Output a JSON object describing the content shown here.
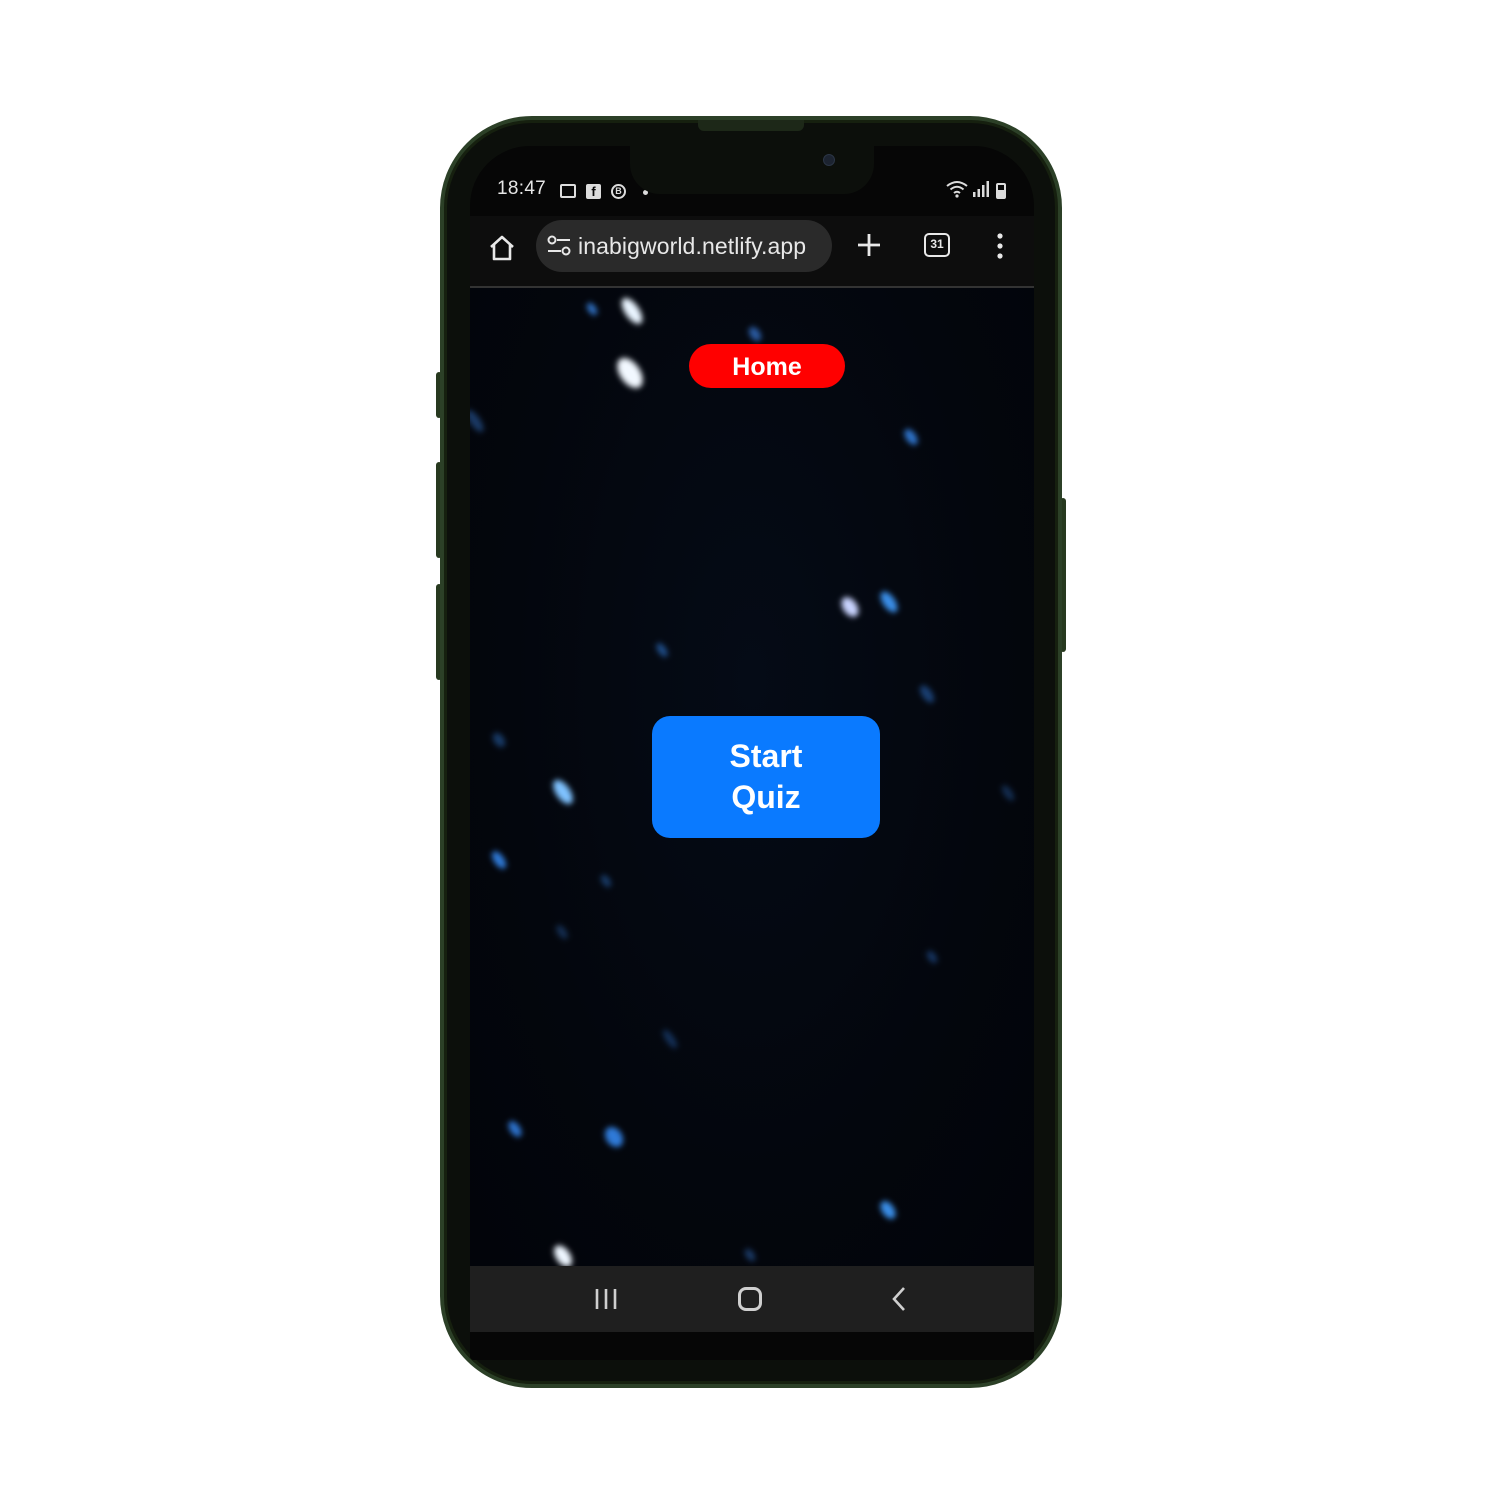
{
  "status_bar": {
    "time": "18:47",
    "left_icons": [
      "gallery-icon",
      "facebook-icon",
      "b-circle-icon",
      "dot-icon"
    ],
    "right_icons": [
      "wifi-icon",
      "signal-icon",
      "battery-charging-icon"
    ]
  },
  "browser": {
    "url": "inabigworld.netlify.app",
    "tab_count": "31",
    "icons": [
      "home-icon",
      "site-settings-icon",
      "new-tab-icon",
      "tabs-icon",
      "menu-icon"
    ]
  },
  "page": {
    "home_label": "Home",
    "start_quiz_label": "Start Quiz",
    "colors": {
      "home_button": "#ff0000",
      "start_button": "#0a7aff",
      "background": "#03060d"
    }
  },
  "nav_bar": {
    "icons": [
      "recent-apps-icon",
      "home-icon",
      "back-icon"
    ]
  }
}
